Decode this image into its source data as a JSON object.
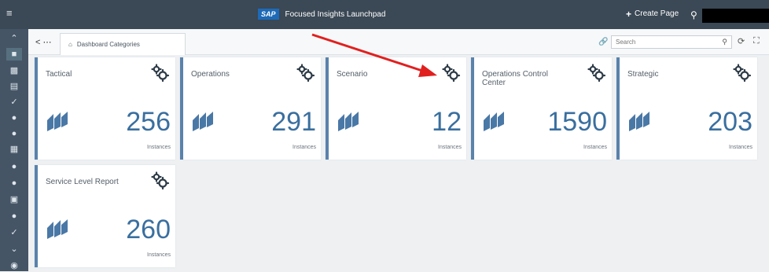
{
  "header": {
    "logo_text": "SAP",
    "title": "Focused Insights Launchpad",
    "create_page_label": "Create Page"
  },
  "subbar": {
    "back_label": "< ⋯",
    "tab_label": "Dashboard Categories",
    "search_placeholder": "Search"
  },
  "tiles": [
    {
      "title": "Tactical",
      "count": "256",
      "unit": "Instances"
    },
    {
      "title": "Operations",
      "count": "291",
      "unit": "Instances"
    },
    {
      "title": "Scenario",
      "count": "12",
      "unit": "Instances"
    },
    {
      "title": "Operations Control Center",
      "count": "1590",
      "unit": "Instances"
    },
    {
      "title": "Strategic",
      "count": "203",
      "unit": "Instances"
    },
    {
      "title": "Service Level Report",
      "count": "260",
      "unit": "Instances"
    }
  ],
  "colors": {
    "accent": "#3a6f9f",
    "annotation_arrow": "#e0201f",
    "shell": "#3b4855"
  }
}
